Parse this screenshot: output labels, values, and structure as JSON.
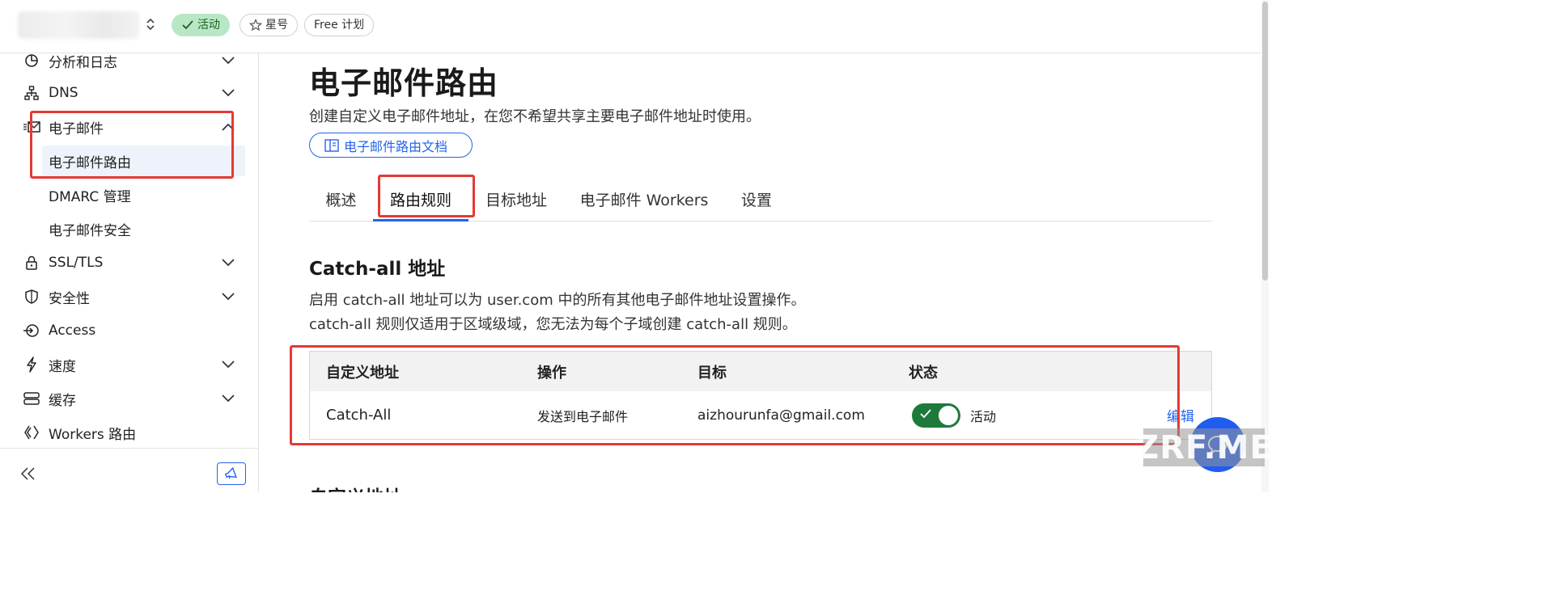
{
  "topbar": {
    "status_badge": "活动",
    "star_badge": "星号",
    "plan_badge": "Free 计划"
  },
  "sidebar": {
    "items": [
      {
        "label": "分析和日志",
        "icon": "pie-chart-icon",
        "expandable": true
      },
      {
        "label": "DNS",
        "icon": "network-icon",
        "expandable": true
      },
      {
        "label": "电子邮件",
        "icon": "email-icon",
        "expandable": true,
        "expanded": true
      },
      {
        "label": "SSL/TLS",
        "icon": "lock-icon",
        "expandable": true
      },
      {
        "label": "安全性",
        "icon": "shield-icon",
        "expandable": true
      },
      {
        "label": "Access",
        "icon": "access-icon",
        "expandable": false
      },
      {
        "label": "速度",
        "icon": "lightning-icon",
        "expandable": true
      },
      {
        "label": "缓存",
        "icon": "database-icon",
        "expandable": true
      },
      {
        "label": "Workers 路由",
        "icon": "workers-icon",
        "expandable": false
      }
    ],
    "email_subitems": [
      {
        "label": "电子邮件路由",
        "selected": true
      },
      {
        "label": "DMARC 管理",
        "selected": false
      },
      {
        "label": "电子邮件安全",
        "selected": false
      }
    ]
  },
  "main": {
    "title": "电子邮件路由",
    "description": "创建自定义电子邮件地址，在您不希望共享主要电子邮件地址时使用。",
    "doc_link": "电子邮件路由文档",
    "tabs": [
      {
        "label": "概述",
        "active": false
      },
      {
        "label": "路由规则",
        "active": true
      },
      {
        "label": "目标地址",
        "active": false
      },
      {
        "label": "电子邮件 Workers",
        "active": false
      },
      {
        "label": "设置",
        "active": false
      }
    ],
    "catchall": {
      "title": "Catch-all 地址",
      "desc_line1": "启用 catch-all 地址可以为 user.com 中的所有其他电子邮件地址设置操作。",
      "desc_line2": "catch-all 规则仅适用于区域级域，您无法为每个子域创建 catch-all 规则。",
      "columns": [
        "自定义地址",
        "操作",
        "目标",
        "状态"
      ],
      "row": {
        "address": "Catch-All",
        "action": "发送到电子邮件",
        "destination": "aizhourunfa@gmail.com",
        "status": "活动",
        "enabled": true,
        "edit": "编辑"
      }
    },
    "next_section_title": "自定义地址"
  },
  "watermark": "ZRF.ME",
  "colors": {
    "accent": "#2563eb",
    "active_badge": "#b9e7c6",
    "toggle_on": "#1e7a3a",
    "annotation": "#e53935"
  }
}
